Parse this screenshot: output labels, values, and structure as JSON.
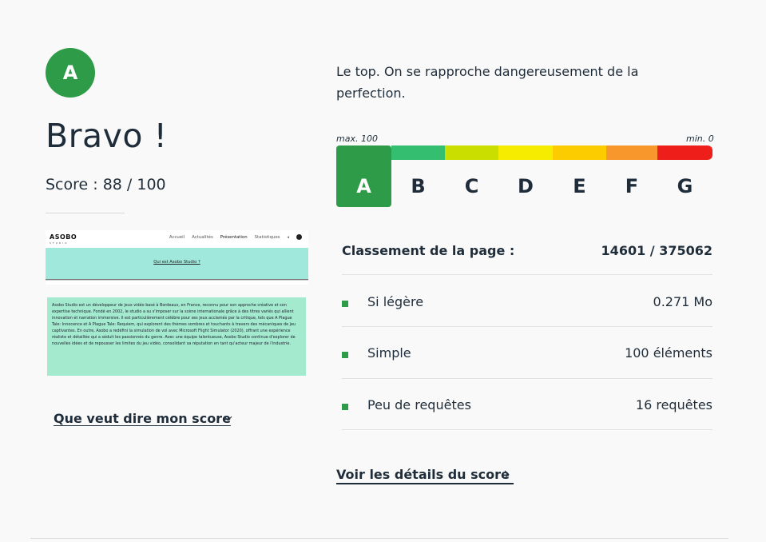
{
  "header": {
    "grade": "A",
    "title": "Bravo !",
    "score_text": "Score : 88 / 100"
  },
  "preview": {
    "logo": "ASOBO",
    "logo_sub": "STUDIO",
    "nav_links": [
      "Accueil",
      "Actualités",
      "Présentation",
      "Statistiques"
    ],
    "hero_link": "Qui est Asobo Studio ?",
    "body_text": "Asobo Studio est un développeur de jeux vidéo basé à Bordeaux, en France, reconnu pour son approche créative et son expertise technique. Fondé en 2002, le studio a su s'imposer sur la scène internationale grâce à des titres variés qui allient innovation et narration immersive. Il est particulièrement célèbre pour ses jeux acclamés par la critique, tels que A Plague Tale: Innocence et A Plague Tale: Requiem, qui explorent des thèmes sombres et touchants à travers des mécaniques de jeu captivantes. En outre, Asobo a redéfini la simulation de vol avec Microsoft Flight Simulator (2020), offrant une expérience réaliste et détaillée qui a séduit les passionnés du genre. Avec une équipe talentueuse, Asobo Studio continue d'explorer de nouvelles idées et de repousser les limites du jeu vidéo, consolidant sa réputation en tant qu'acteur majeur de l'industrie."
  },
  "meaning_link": "Que veut dire mon score",
  "description": "Le top. On se rapproche dangereusement de la perfection.",
  "scale": {
    "max_label": "max. 100",
    "min_label": "min. 0",
    "grades": [
      "A",
      "B",
      "C",
      "D",
      "E",
      "F",
      "G"
    ],
    "active": "A",
    "colors": [
      "#2e9b48",
      "#34be6f",
      "#cadf00",
      "#f5ec00",
      "#fdcc00",
      "#f8972c",
      "#ee1e1b"
    ]
  },
  "ranking": {
    "label": "Classement de la page :",
    "value": "14601 / 375062"
  },
  "metrics": [
    {
      "label": "Si légère",
      "value": "0.271 Mo"
    },
    {
      "label": "Simple",
      "value": "100 éléments"
    },
    {
      "label": "Peu de requêtes",
      "value": "16 requêtes"
    }
  ],
  "details_link": "Voir les détails du score"
}
